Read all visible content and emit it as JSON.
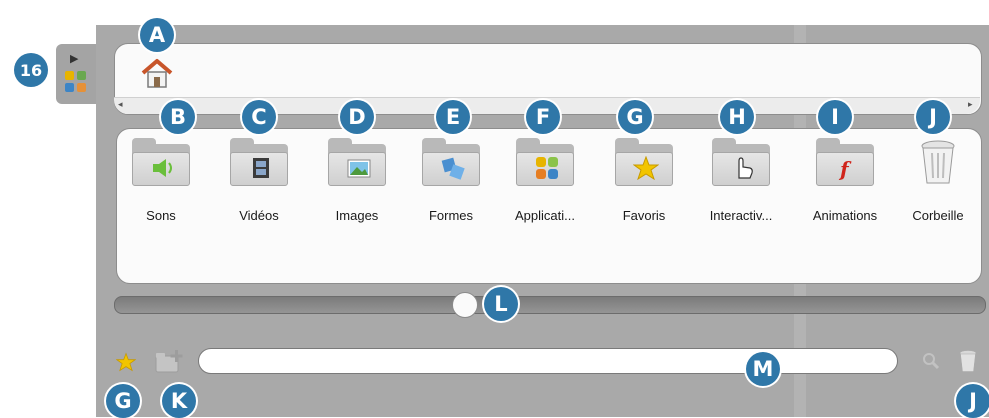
{
  "side_tab": {
    "callout": "16",
    "play_icon": "play-icon",
    "apps_icon": "apps-grid-icon"
  },
  "path_bar": {
    "home_icon": "home-icon",
    "scroll_left": "◂",
    "scroll_right": "▸"
  },
  "callouts": {
    "A": "A",
    "B": "B",
    "C": "C",
    "D": "D",
    "E": "E",
    "F": "F",
    "G": "G",
    "H": "H",
    "I": "I",
    "J": "J",
    "K": "K",
    "L": "L",
    "M": "M"
  },
  "folders": [
    {
      "label": "Sons",
      "icon": "speaker-folder-icon",
      "callout": "B"
    },
    {
      "label": "Vidéos",
      "icon": "film-folder-icon",
      "callout": "C"
    },
    {
      "label": "Images",
      "icon": "picture-folder-icon",
      "callout": "D"
    },
    {
      "label": "Formes",
      "icon": "shapes-folder-icon",
      "callout": "E"
    },
    {
      "label": "Applicati...",
      "icon": "apps-folder-icon",
      "callout": "F"
    },
    {
      "label": "Favoris",
      "icon": "star-folder-icon",
      "callout": "G"
    },
    {
      "label": "Interactiv...",
      "icon": "hand-cursor-folder-icon",
      "callout": "H"
    },
    {
      "label": "Animations",
      "icon": "flash-folder-icon",
      "callout": "I"
    },
    {
      "label": "Corbeille",
      "icon": "trash-icon",
      "callout": "J"
    }
  ],
  "slider": {
    "value_fraction": 0.4
  },
  "bottom_bar": {
    "favorite_icon": "star-icon",
    "add_folder_icon": "add-folder-icon",
    "search_placeholder": "",
    "search_icon": "magnifier-icon",
    "trash_icon": "trash-icon"
  },
  "colors": {
    "callout": "#2f77a8",
    "panel": "#a9a9a9",
    "star": "#f2c500",
    "flash": "#d0241b"
  }
}
